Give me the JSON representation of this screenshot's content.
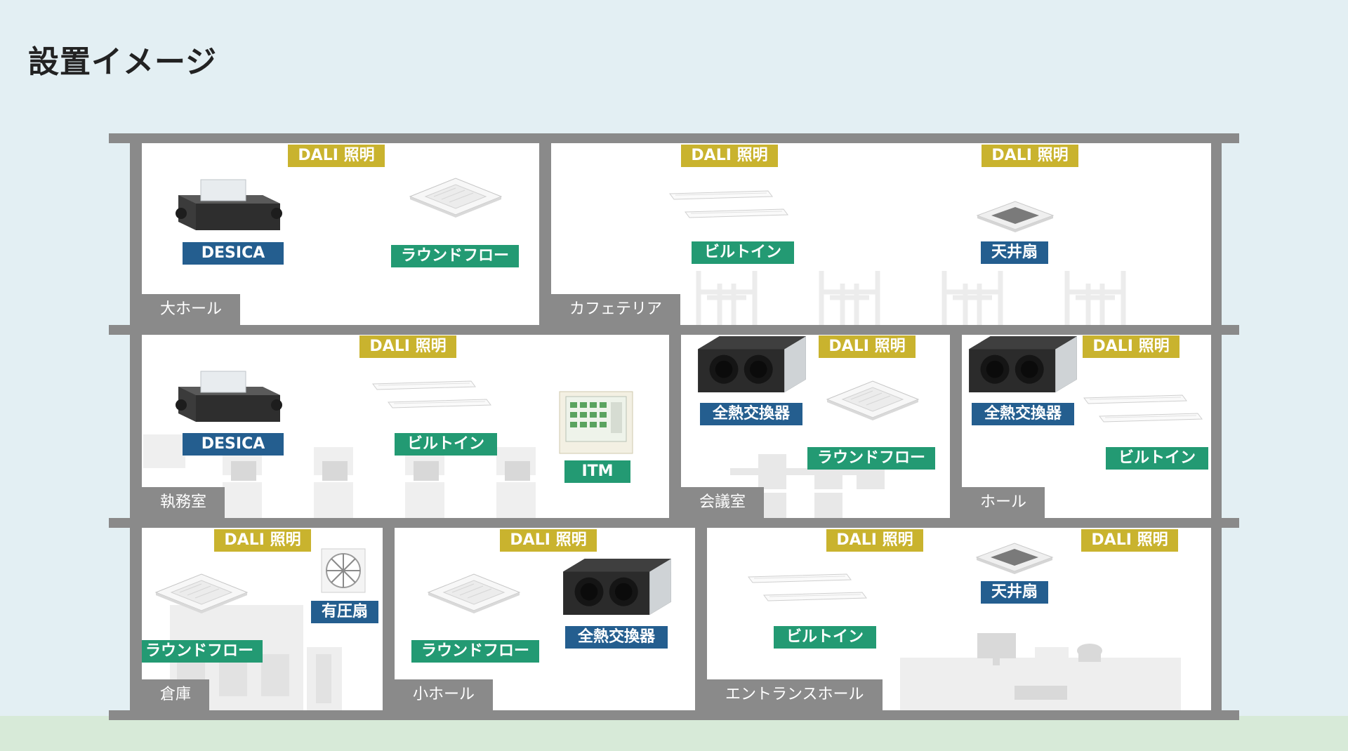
{
  "page": {
    "title": "設置イメージ"
  },
  "colors": {
    "dali": "#c9b32e",
    "blue_tag": "#245e8f",
    "green_tag": "#239a73",
    "wall": "#8a8a8a",
    "sky": "#e3eff3",
    "ground": "#d7ead8"
  },
  "rooms": {
    "grand_hall": {
      "name": "大ホール"
    },
    "cafeteria": {
      "name": "カフェテリア"
    },
    "office": {
      "name": "執務室"
    },
    "meeting_room": {
      "name": "会議室"
    },
    "hall": {
      "name": "ホール"
    },
    "warehouse": {
      "name": "倉庫"
    },
    "small_hall": {
      "name": "小ホール"
    },
    "entrance_hall": {
      "name": "エントランスホール"
    }
  },
  "tags": {
    "dali": "DALI 照明",
    "desica": "DESICA",
    "round_flow": "ラウンドフロー",
    "built_in": "ビルトイン",
    "ceiling_fan": "天井扇",
    "itm": "ITM",
    "heat_exchanger": "全熱交換器",
    "pressure_fan": "有圧扇"
  },
  "icons": [
    "desica-unit-icon",
    "round-flow-cassette-icon",
    "built-in-unit-icon",
    "ceiling-fan-icon",
    "itm-controller-icon",
    "heat-exchanger-icon",
    "pressure-fan-icon"
  ]
}
